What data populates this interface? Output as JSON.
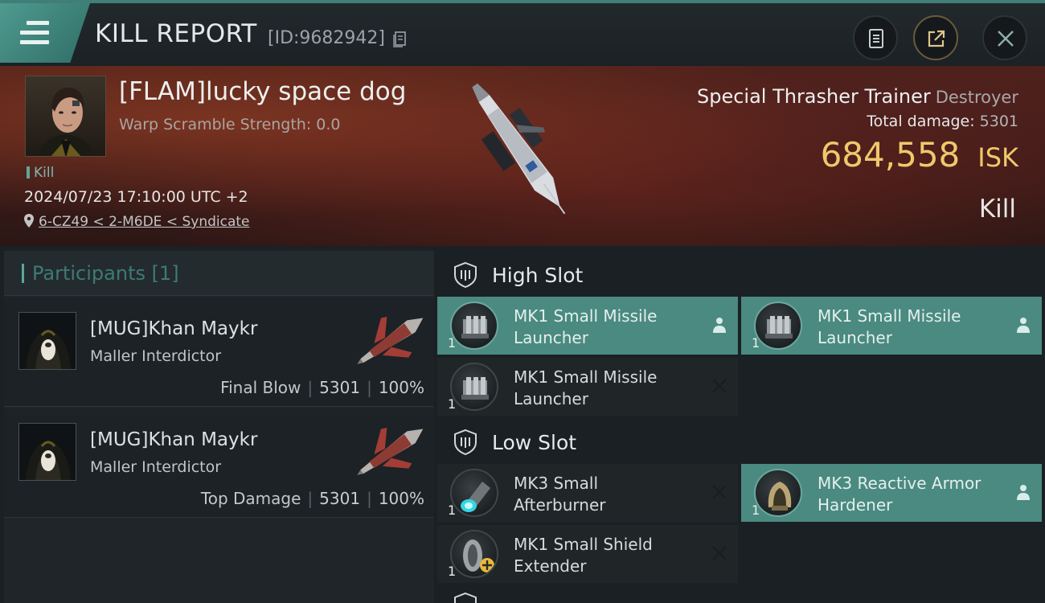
{
  "header": {
    "title": "KILL REPORT",
    "report_id": "[ID:9682942]",
    "icons": [
      "menu-icon",
      "copy-icon",
      "notes-icon",
      "share-icon",
      "close-icon"
    ]
  },
  "victim": {
    "name": "[FLAM]lucky space dog",
    "warp_scramble": "Warp Scramble Strength: 0.0",
    "kill_tag": "Kill",
    "time": "2024/07/23 17:10:00 UTC +2",
    "location": "6-CZ49 < 2-M6DE < Syndicate",
    "ship_name": "Special Thrasher Trainer",
    "ship_class": "Destroyer",
    "total_damage_label": "Total damage:",
    "total_damage_value": "5301",
    "isk_value": "684,558",
    "isk_unit": "ISK",
    "result": "Kill"
  },
  "participants": {
    "title": "Participants [1]",
    "items": [
      {
        "name": "[MUG]Khan Maykr",
        "ship": "Maller Interdictor",
        "label": "Final Blow",
        "damage": "5301",
        "percent": "100%"
      },
      {
        "name": "[MUG]Khan Maykr",
        "ship": "Maller Interdictor",
        "label": "Top Damage",
        "damage": "5301",
        "percent": "100%"
      }
    ]
  },
  "fitting": {
    "high_slot": {
      "title": "High Slot",
      "modules": [
        {
          "name_line1": "MK1 Small Missile",
          "name_line2": "Launcher",
          "qty": "1",
          "state": "pilot-icon"
        },
        {
          "name_line1": "MK1 Small Missile",
          "name_line2": "Launcher",
          "qty": "1",
          "state": "pilot-icon"
        },
        {
          "name_line1": "MK1 Small Missile",
          "name_line2": "Launcher",
          "qty": "1",
          "state": "destroyed-x-icon"
        }
      ]
    },
    "low_slot": {
      "title": "Low Slot",
      "modules": [
        {
          "name_line1": "MK3 Small",
          "name_line2": "Afterburner",
          "qty": "1",
          "state": "destroyed-x-icon"
        },
        {
          "name_line1": "MK3 Reactive Armor",
          "name_line2": "Hardener",
          "qty": "1",
          "state": "pilot-icon"
        },
        {
          "name_line1": "MK1 Small Shield",
          "name_line2": "Extender",
          "qty": "1",
          "state": "destroyed-x-icon"
        }
      ]
    }
  },
  "colors": {
    "accent_teal": "#4a8a80",
    "isk_gold": "#f0c86b",
    "background": "#1b2024"
  }
}
